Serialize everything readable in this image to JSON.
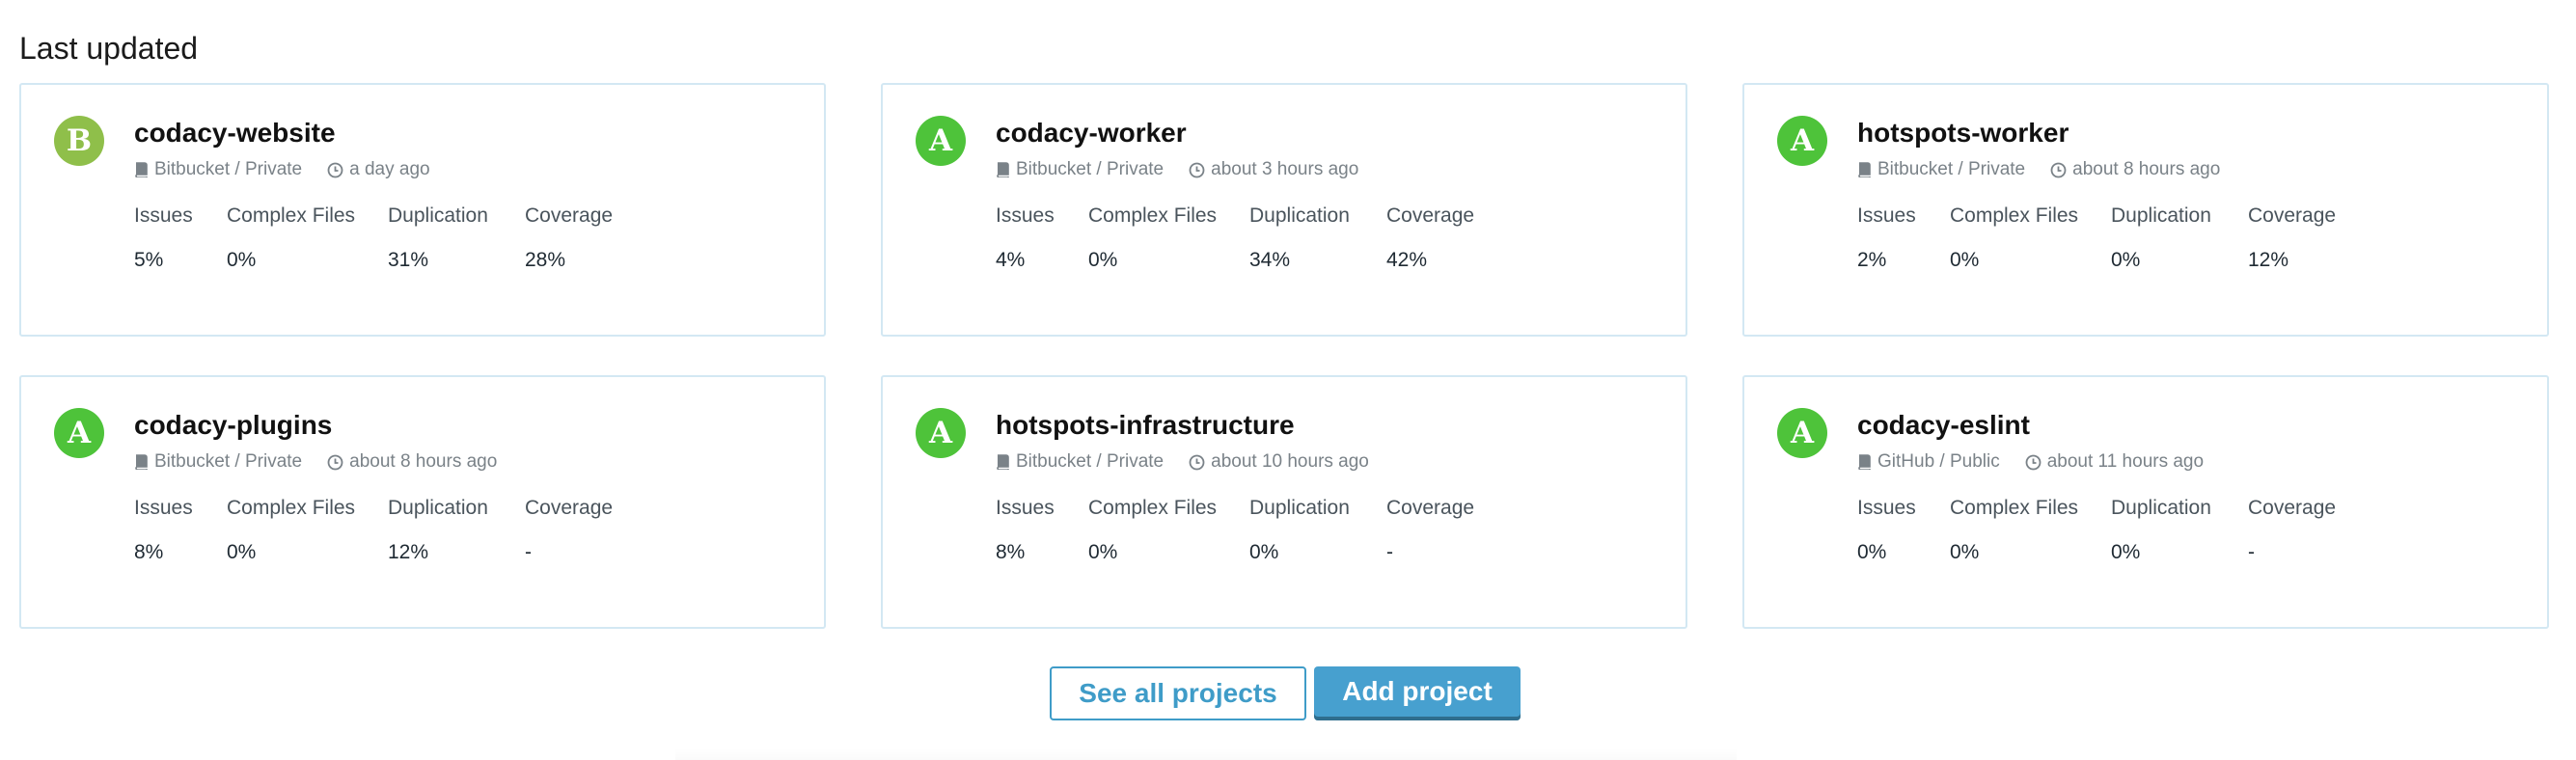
{
  "section": {
    "title": "Last updated"
  },
  "colors": {
    "grade_a": "#4ec33a",
    "grade_b": "#8fbf4a",
    "accent": "#3f9cc8",
    "card_border": "#d3e8f3"
  },
  "icons": {
    "provider": "book-icon",
    "time": "clock-icon"
  },
  "metric_labels": [
    "Issues",
    "Complex Files",
    "Duplication",
    "Coverage"
  ],
  "projects": [
    {
      "grade": "B",
      "name": "codacy-website",
      "provider": "Bitbucket / Private",
      "updated": "a day ago",
      "issues": "5%",
      "complex_files": "0%",
      "duplication": "31%",
      "coverage": "28%"
    },
    {
      "grade": "A",
      "name": "codacy-worker",
      "provider": "Bitbucket / Private",
      "updated": "about 3 hours ago",
      "issues": "4%",
      "complex_files": "0%",
      "duplication": "34%",
      "coverage": "42%"
    },
    {
      "grade": "A",
      "name": "hotspots-worker",
      "provider": "Bitbucket / Private",
      "updated": "about 8 hours ago",
      "issues": "2%",
      "complex_files": "0%",
      "duplication": "0%",
      "coverage": "12%"
    },
    {
      "grade": "A",
      "name": "codacy-plugins",
      "provider": "Bitbucket / Private",
      "updated": "about 8 hours ago",
      "issues": "8%",
      "complex_files": "0%",
      "duplication": "12%",
      "coverage": "-"
    },
    {
      "grade": "A",
      "name": "hotspots-infrastructure",
      "provider": "Bitbucket / Private",
      "updated": "about 10 hours ago",
      "issues": "8%",
      "complex_files": "0%",
      "duplication": "0%",
      "coverage": "-"
    },
    {
      "grade": "A",
      "name": "codacy-eslint",
      "provider": "GitHub / Public",
      "updated": "about 11 hours ago",
      "issues": "0%",
      "complex_files": "0%",
      "duplication": "0%",
      "coverage": "-"
    }
  ],
  "buttons": {
    "see_all": "See all projects",
    "add": "Add project"
  }
}
